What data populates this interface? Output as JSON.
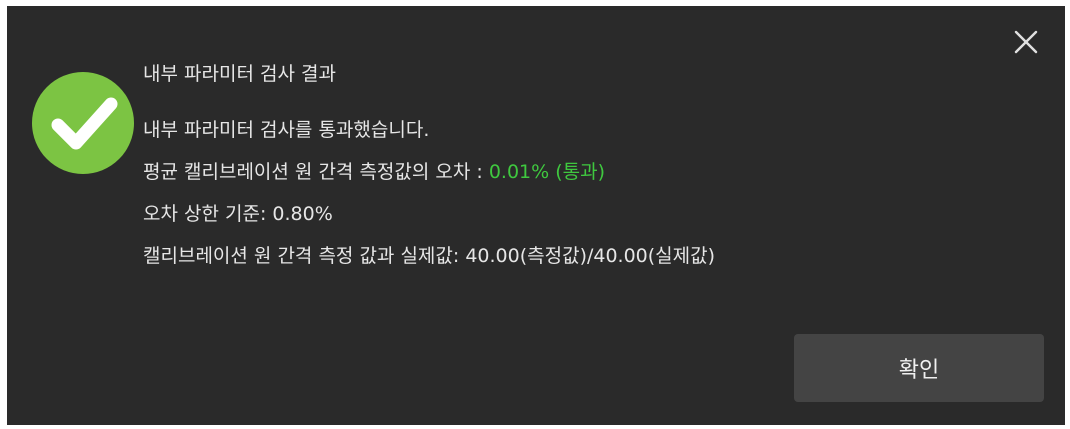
{
  "dialog": {
    "title": "내부 파라미터 검사 결과",
    "close_icon": "close-icon",
    "status_icon": "check-circle-icon",
    "colors": {
      "background": "#2a2a2a",
      "pass": "#3fc83f",
      "success_icon": "#7cc443",
      "button": "#444444"
    },
    "message": "내부 파라미터 검사를 통과했습니다.",
    "avg_error": {
      "label": "평균 캘리브레이션 원 간격 측정값의 오차 : ",
      "value": "0.01% (통과)"
    },
    "error_limit": "오차 상한 기준: 0.80%",
    "comparison": "캘리브레이션 원 간격 측정 값과 실제값: 40.00(측정값)/40.00(실제값)",
    "confirm_label": "확인"
  }
}
